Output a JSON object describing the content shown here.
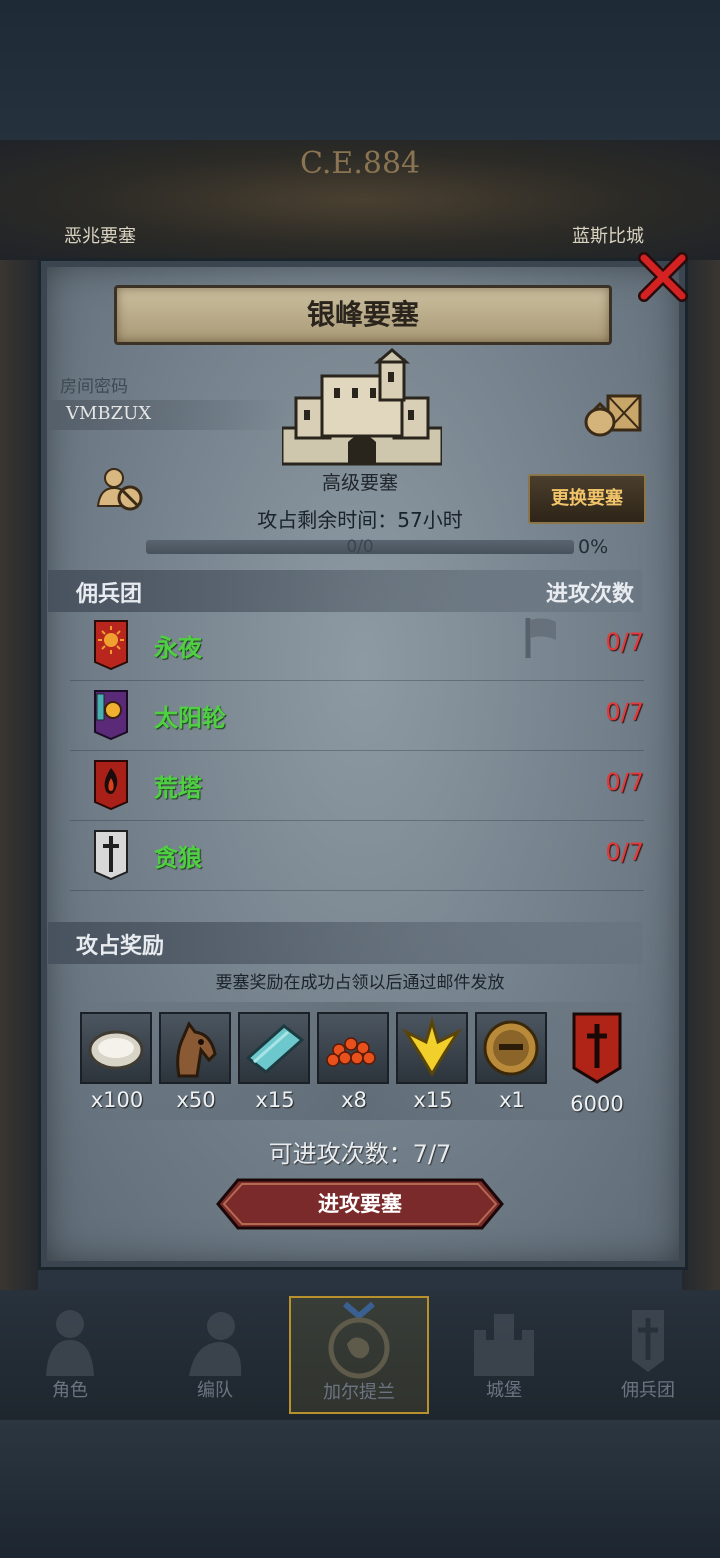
{
  "map": {
    "era": "C.E.884",
    "city_left": "恶兆要塞",
    "city_right": "蓝斯比城"
  },
  "dialog": {
    "title": "银峰要塞",
    "room_label": "房间密码",
    "room_code": "VMBZUX",
    "fortress_type": "高级要塞",
    "remaining_label": "攻占剩余时间：57小时",
    "change_button": "更换要塞",
    "progress_text": "0/0",
    "progress_percent": "0%",
    "progress_fraction": 0
  },
  "mercenaries": {
    "header": "佣兵团",
    "count_header": "进攻次数",
    "rows": [
      {
        "name": "永夜",
        "count": "0/7",
        "banner": "sun-banner-icon",
        "color": "#b8261e"
      },
      {
        "name": "太阳轮",
        "count": "0/7",
        "banner": "sunwheel-banner-icon",
        "color": "#5a2a78"
      },
      {
        "name": "荒塔",
        "count": "0/7",
        "banner": "fire-banner-icon",
        "color": "#a82018"
      },
      {
        "name": "贪狼",
        "count": "0/7",
        "banner": "sword-banner-icon",
        "color": "#d8d8d8"
      }
    ]
  },
  "rewards": {
    "header": "攻占奖励",
    "note": "要塞奖励在成功占领以后通过邮件发放",
    "items": [
      {
        "icon": "oyster-icon",
        "qty": "x100"
      },
      {
        "icon": "horse-icon",
        "qty": "x50"
      },
      {
        "icon": "cloth-icon",
        "qty": "x15"
      },
      {
        "icon": "caviar-icon",
        "qty": "x8"
      },
      {
        "icon": "gold-crest-icon",
        "qty": "x15"
      },
      {
        "icon": "helmet-medal-icon",
        "qty": "x1"
      },
      {
        "icon": "red-banner-icon",
        "qty": "6000"
      }
    ],
    "attempts": "可进攻次数：7/7",
    "attack_button": "进攻要塞"
  },
  "nav": {
    "items": [
      {
        "label": "角色",
        "icon": "knight-icon"
      },
      {
        "label": "编队",
        "icon": "formation-icon"
      },
      {
        "label": "加尔提兰",
        "icon": "map-icon"
      },
      {
        "label": "城堡",
        "icon": "castle-icon"
      },
      {
        "label": "佣兵团",
        "icon": "mercenary-icon"
      }
    ]
  },
  "colors": {
    "merc_name": "#4ed040",
    "attack_count": "#e03a3a",
    "button_gold": "#f2c46a",
    "attack_button": "#7a2a2a"
  }
}
